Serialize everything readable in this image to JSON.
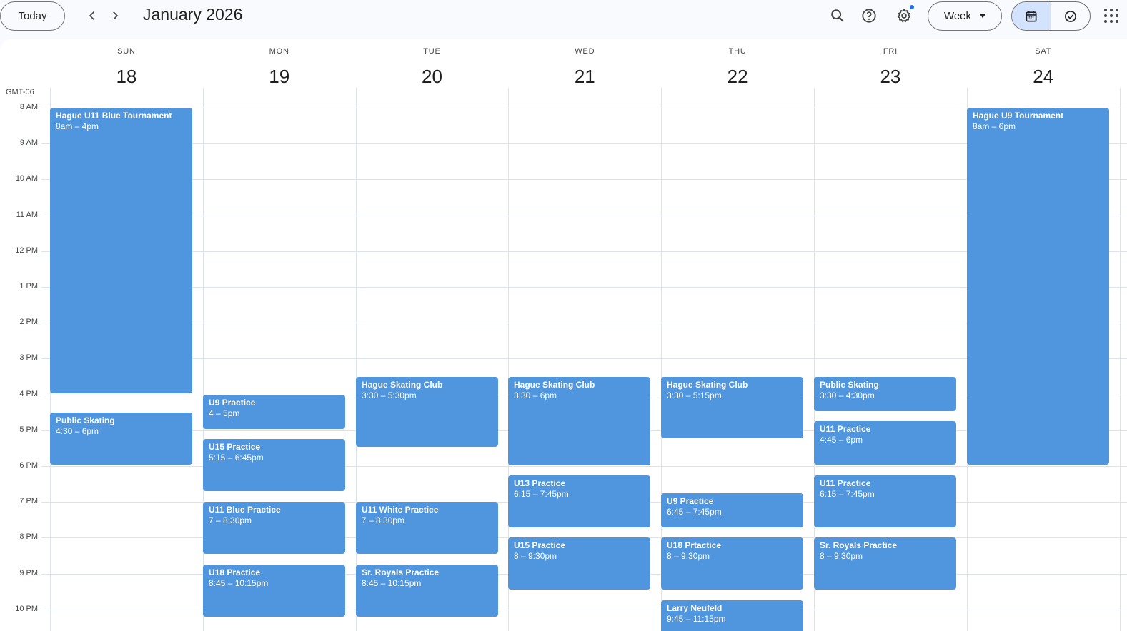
{
  "header": {
    "today_label": "Today",
    "month_title": "January 2026",
    "view_label": "Week",
    "icons": [
      "chevron-left-icon",
      "chevron-right-icon",
      "search-icon",
      "help-icon",
      "gear-icon",
      "calendar-icon",
      "tasks-check-icon",
      "apps-grid-icon"
    ]
  },
  "timezone": "GMT-06",
  "days": [
    {
      "name": "SUN",
      "num": "18"
    },
    {
      "name": "MON",
      "num": "19"
    },
    {
      "name": "TUE",
      "num": "20"
    },
    {
      "name": "WED",
      "num": "21"
    },
    {
      "name": "THU",
      "num": "22"
    },
    {
      "name": "FRI",
      "num": "23"
    },
    {
      "name": "SAT",
      "num": "24"
    }
  ],
  "hours": [
    "8 AM",
    "9 AM",
    "10 AM",
    "11 AM",
    "12 PM",
    "1 PM",
    "2 PM",
    "3 PM",
    "4 PM",
    "5 PM",
    "6 PM",
    "7 PM",
    "8 PM",
    "9 PM",
    "10 PM"
  ],
  "colors": {
    "event": "#5096de",
    "accent": "#1a73e8",
    "selected": "#d3e3fd"
  },
  "events": [
    {
      "day": 0,
      "start": 8,
      "end": 16,
      "title": "Hague U11 Blue Tournament",
      "time": "8am – 4pm"
    },
    {
      "day": 0,
      "start": 16.5,
      "end": 18,
      "title": "Public Skating",
      "time": "4:30 – 6pm"
    },
    {
      "day": 1,
      "start": 16,
      "end": 17,
      "title": "U9 Practice",
      "time": "4 – 5pm"
    },
    {
      "day": 1,
      "start": 17.25,
      "end": 18.75,
      "title": "U15 Practice",
      "time": "5:15 – 6:45pm"
    },
    {
      "day": 1,
      "start": 19,
      "end": 20.5,
      "title": "U11 Blue Practice",
      "time": "7 – 8:30pm"
    },
    {
      "day": 1,
      "start": 20.75,
      "end": 22.25,
      "title": "U18 Practice",
      "time": "8:45 – 10:15pm"
    },
    {
      "day": 2,
      "start": 15.5,
      "end": 17.5,
      "title": "Hague Skating Club",
      "time": "3:30 – 5:30pm"
    },
    {
      "day": 2,
      "start": 19,
      "end": 20.5,
      "title": "U11 White Practice",
      "time": "7 – 8:30pm"
    },
    {
      "day": 2,
      "start": 20.75,
      "end": 22.25,
      "title": "Sr. Royals Practice",
      "time": "8:45 – 10:15pm"
    },
    {
      "day": 3,
      "start": 15.5,
      "end": 18,
      "title": "Hague Skating Club",
      "time": "3:30 – 6pm"
    },
    {
      "day": 3,
      "start": 18.25,
      "end": 19.75,
      "title": "U13 Practice",
      "time": "6:15 – 7:45pm"
    },
    {
      "day": 3,
      "start": 20,
      "end": 21.5,
      "title": "U15 Practice",
      "time": "8 – 9:30pm"
    },
    {
      "day": 4,
      "start": 15.5,
      "end": 17.25,
      "title": "Hague Skating Club",
      "time": "3:30 – 5:15pm"
    },
    {
      "day": 4,
      "start": 18.75,
      "end": 19.75,
      "title": "U9 Practice",
      "time": "6:45 – 7:45pm"
    },
    {
      "day": 4,
      "start": 20,
      "end": 21.5,
      "title": "U18 Prtactice",
      "time": "8 – 9:30pm"
    },
    {
      "day": 4,
      "start": 21.75,
      "end": 23.25,
      "title": "Larry Neufeld",
      "time": "9:45 – 11:15pm"
    },
    {
      "day": 5,
      "start": 15.5,
      "end": 16.5,
      "title": "Public Skating",
      "time": "3:30 – 4:30pm"
    },
    {
      "day": 5,
      "start": 16.75,
      "end": 18,
      "title": "U11 Practice",
      "time": "4:45 – 6pm"
    },
    {
      "day": 5,
      "start": 18.25,
      "end": 19.75,
      "title": "U11 Practice",
      "time": "6:15 – 7:45pm"
    },
    {
      "day": 5,
      "start": 20,
      "end": 21.5,
      "title": "Sr. Royals Practice",
      "time": "8 – 9:30pm"
    },
    {
      "day": 6,
      "start": 8,
      "end": 18,
      "title": "Hague U9 Tournament",
      "time": "8am – 6pm"
    }
  ]
}
